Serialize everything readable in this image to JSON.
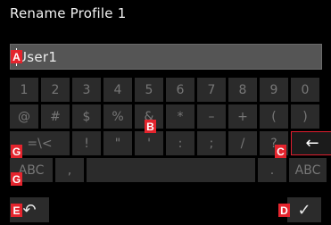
{
  "title": "Rename Profile 1",
  "input": {
    "value": "User1"
  },
  "keyboard": {
    "row1": [
      "1",
      "2",
      "3",
      "4",
      "5",
      "6",
      "7",
      "8",
      "9",
      "0"
    ],
    "row2": [
      "@",
      "#",
      "$",
      "%",
      "&",
      "*",
      "–",
      "+",
      "(",
      ")"
    ],
    "row3": {
      "mode": "=\\<",
      "keys": [
        "!",
        "\"",
        "'",
        ":",
        ";",
        "/",
        "?"
      ],
      "enter": "←"
    },
    "row4": {
      "left_mode": "ABC",
      "comma": ",",
      "period": ".",
      "right_mode": "ABC"
    },
    "bottom": {
      "back": "↶",
      "confirm": "✓"
    }
  },
  "labels": {
    "a": "A",
    "b": "B",
    "c": "C",
    "d": "D",
    "e": "E",
    "g1": "G",
    "g2": "G"
  },
  "colors": {
    "accent": "#e4242d",
    "key_bg": "#2b2b2b",
    "key_text": "#777777"
  }
}
